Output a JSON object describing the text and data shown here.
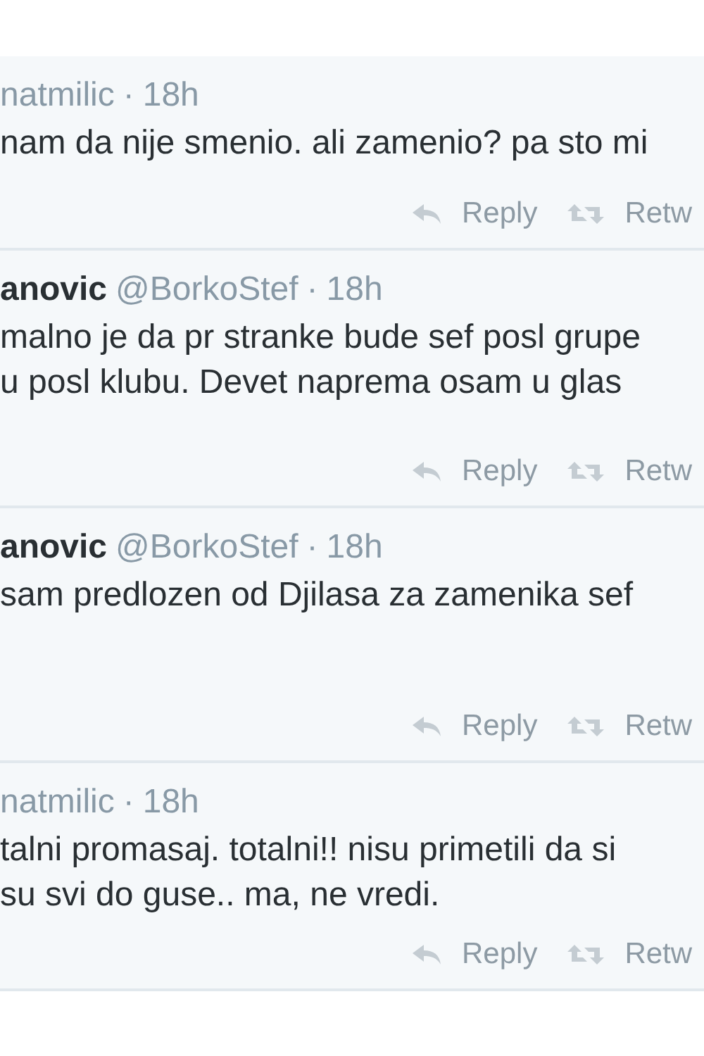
{
  "tweets": [
    {
      "handle": "natmilic",
      "separator": "·",
      "time": "18h",
      "body_lines": [
        "nam da nije smenio. ali zamenio? pa sto mi"
      ],
      "actions": [
        "Reply",
        "Retw"
      ]
    },
    {
      "name": "anovic",
      "handle": "@BorkoStef",
      "separator": "·",
      "time": "18h",
      "body_lines": [
        "malno je da pr stranke bude sef posl grupe",
        "u posl klubu. Devet naprema osam u glas"
      ],
      "actions": [
        "Reply",
        "Retw"
      ]
    },
    {
      "name": "anovic",
      "handle": "@BorkoStef",
      "separator": "·",
      "time": "18h",
      "body_lines": [
        "sam predlozen od Djilasa za zamenika sef"
      ],
      "actions": [
        "Reply",
        "Retw"
      ]
    },
    {
      "handle": "natmilic",
      "separator": "·",
      "time": "18h",
      "body_lines": [
        "talni promasaj. totalni!! nisu primetili da si",
        "su svi do guse.. ma, ne vredi."
      ],
      "actions": [
        "Reply",
        "Retw"
      ]
    }
  ]
}
